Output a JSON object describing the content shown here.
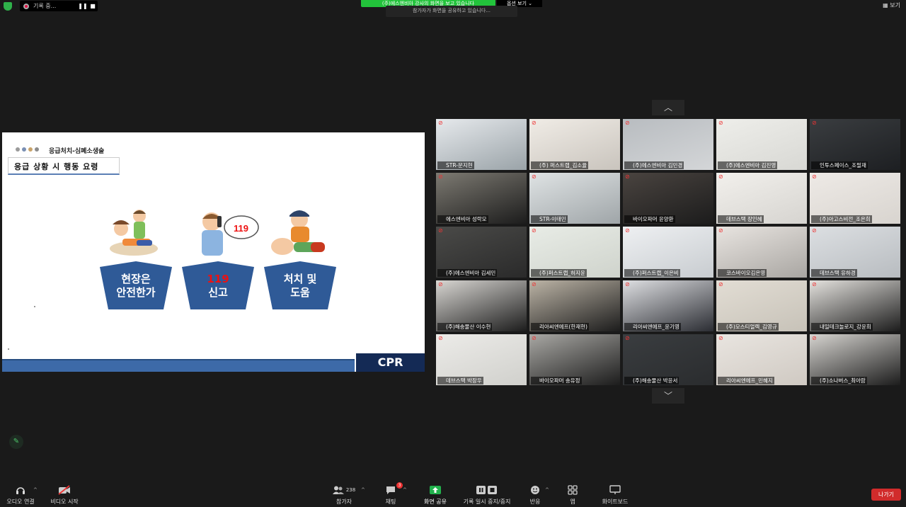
{
  "top_bar": {
    "recording_label": "기록 중...",
    "share_banner": "(주)에스엔비아 강사의 화면을 보고 있습니다",
    "view_options": "옵션 보기",
    "tooltip": "참가자가 화면을 공유하고 있습니다...",
    "view_button": "보기"
  },
  "slide": {
    "breadcrumb": "응급처치-심폐소생술",
    "heading": "응급 상황 시 행동 요령",
    "steps": [
      {
        "line1": "현장은",
        "line2": "안전한가"
      },
      {
        "line1": "119",
        "line2": "신고"
      },
      {
        "line1": "처치 및",
        "line2": "도움"
      }
    ],
    "badge_119": "119",
    "footer_label": "CPR",
    "colors": {
      "pentagon": "#2f5a97",
      "footer": "#3d6aa8",
      "cpr_box": "#142a55",
      "accent_red": "#e11111"
    }
  },
  "gallery": {
    "up_arrow": "︿",
    "down_arrow": "﹀",
    "participants": [
      {
        "name": "STR-문지현"
      },
      {
        "name": "(주) 퍼스트랩_김소율"
      },
      {
        "name": "(주)에스엔비아 김민경"
      },
      {
        "name": "(주)에스엔비아 김진영"
      },
      {
        "name": "인투스페이스_조필재"
      },
      {
        "name": "에스엔비아 성락모"
      },
      {
        "name": "STR-이태민"
      },
      {
        "name": "바이오파머 윤양환"
      },
      {
        "name": "데브스택 장인혜"
      },
      {
        "name": "(주)아고스비전_조은희"
      },
      {
        "name": "(주)에스엔비아 김세민"
      },
      {
        "name": "(주)퍼스트랩_허지윤"
      },
      {
        "name": "(주)퍼스트랩_이은비"
      },
      {
        "name": "코스바이오김은영"
      },
      {
        "name": "데브스택 유하경"
      },
      {
        "name": "(주)해송물산 이수현"
      },
      {
        "name": "리아씨엔에프(한재현)"
      },
      {
        "name": "리아씨엔에프_윤기영"
      },
      {
        "name": "(주)모스티얼렉_김영규"
      },
      {
        "name": "내일테크놀로지_강윤희"
      },
      {
        "name": "데브스택 박장우"
      },
      {
        "name": "바이오파머 송유정"
      },
      {
        "name": "(주)해송물산 박윤서"
      },
      {
        "name": "리아씨엔에프_민혜지"
      },
      {
        "name": "(주)소나버스_최아람"
      }
    ]
  },
  "toolbar": {
    "audio": "오디오 연결",
    "video": "비디오 시작",
    "participants": "참가자",
    "participant_count": "238",
    "chat": "채팅",
    "chat_badge": "3",
    "share": "화면 공유",
    "record": "기록 일시 중지/중지",
    "reactions": "반응",
    "apps": "앱",
    "whiteboard": "화이트보드",
    "leave": "나가기"
  }
}
